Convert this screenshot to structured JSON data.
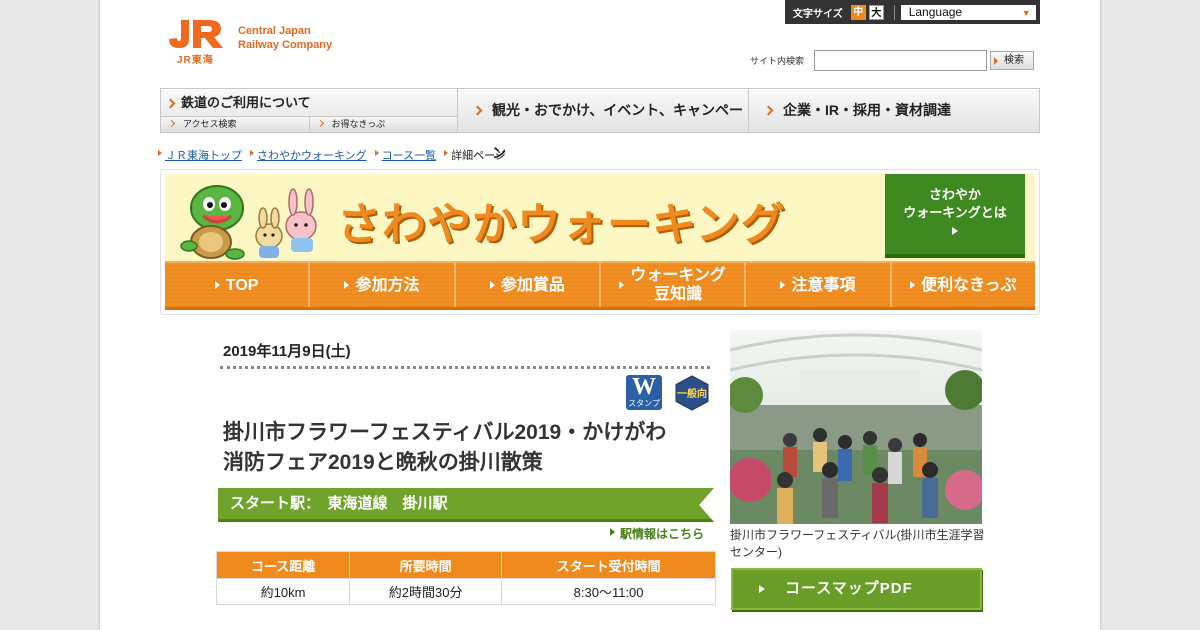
{
  "header": {
    "logo_mark": "JR",
    "logo_sub": "JR東海",
    "company_line1": "Central Japan",
    "company_line2": "Railway Company",
    "font_size_label": "文字サイズ",
    "font_size_medium": "中",
    "font_size_large": "大",
    "language_label": "Language",
    "search_label": "サイト内検索",
    "search_value": "",
    "search_button": "検索"
  },
  "gnav": {
    "item1": "鉄道のご利用について",
    "sub1": "アクセス検索",
    "sub2": "お得なきっぷ",
    "item2": "観光・おでかけ、イベント、キャンペーン",
    "item3": "企業・IR・採用・資材調達"
  },
  "breadcrumb": {
    "c1": "ＪＲ東海トップ",
    "c2": "さわやかウォーキング",
    "c3": "コース一覧",
    "c4": "詳細ページ"
  },
  "banner": {
    "title": "さわやかウォーキング",
    "about_line1": "さわやか",
    "about_line2": "ウォーキングとは",
    "tabs": [
      "TOP",
      "参加方法",
      "参加賞品",
      "ウォーキング\n豆知識",
      "注意事項",
      "便利なきっぷ"
    ]
  },
  "detail": {
    "date": "2019年11月9日(土)",
    "badge_w": "W",
    "badge_w_sub": "スタンプ",
    "badge_general": "一般向",
    "title_line1": "掛川市フラワーフェスティバル2019・かけがわ",
    "title_line2": "消防フェア2019と晩秋の掛川散策",
    "start_station": "スタート駅：　東海道線　掛川駅",
    "station_info_link": "駅情報はこちら",
    "table_headers": [
      "コース距離",
      "所要時間",
      "スタート受付時間"
    ],
    "table_values": [
      "約10km",
      "約2時間30分",
      "8:30～11:00"
    ],
    "photo_caption": "掛川市フラワーフェスティバル(掛川市生涯学習センター)",
    "course_map_button": "コースマップPDF"
  },
  "colors": {
    "brand_orange": "#ef8a1d",
    "green": "#6fa32a",
    "link_blue": "#1a5bb5"
  }
}
